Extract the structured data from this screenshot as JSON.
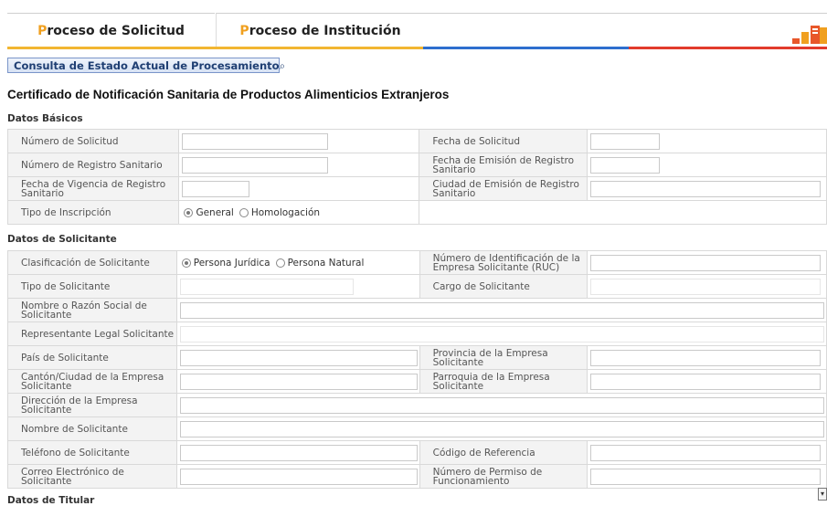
{
  "nav": {
    "tab1_first": "P",
    "tab1_rest": "roceso de Solicitud",
    "tab2_first": "P",
    "tab2_rest": "roceso de Institución"
  },
  "consult_button": {
    "label": "Consulta de Estado Actual de Procesamiento",
    "icon": "search-icon"
  },
  "page_title": "Certificado de Notificación Sanitaria de Productos Alimenticios Extranjeros",
  "basic": {
    "title": "Datos Básicos",
    "solicitud_numero": "Número de Solicitud",
    "solicitud_fecha": "Fecha de Solicitud",
    "registro_numero": "Número de Registro Sanitario",
    "emision_fecha": "Fecha de Emisión de Registro Sanitario",
    "vigencia_fecha": "Fecha de Vigencia de Registro Sanitario",
    "emision_ciudad": "Ciudad de Emisión de Registro Sanitario",
    "inscripcion_tipo": "Tipo de Inscripción",
    "opt_general": "General",
    "opt_homologacion": "Homologación"
  },
  "applicant": {
    "title": "Datos de Solicitante",
    "clasificacion": "Clasificación de Solicitante",
    "opt_juridica": "Persona Jurídica",
    "opt_natural": "Persona Natural",
    "ruc": "Número de Identificación de la Empresa Solicitante (RUC)",
    "tipo": "Tipo de Solicitante",
    "cargo": "Cargo de Solicitante",
    "razon_social": "Nombre o Razón Social de Solicitante",
    "representante": "Representante Legal Solicitante",
    "pais": "País de Solicitante",
    "provincia": "Provincia de la Empresa Solicitante",
    "canton": "Cantón/Ciudad de la Empresa Solicitante",
    "parroquia": "Parroquia de la Empresa Solicitante",
    "direccion": "Dirección de la Empresa Solicitante",
    "nombre": "Nombre de Solicitante",
    "telefono": "Teléfono de Solicitante",
    "referencia": "Código de Referencia",
    "correo": "Correo Electrónico de Solicitante",
    "permiso": "Número de Permiso de Funcionamiento"
  },
  "titular": {
    "title": "Datos de Titular"
  },
  "colors": {
    "tab_accent": "#f0a020",
    "bar_yellow": "#f2b632",
    "bar_blue": "#2e6fce",
    "bar_red": "#e23b2c"
  }
}
